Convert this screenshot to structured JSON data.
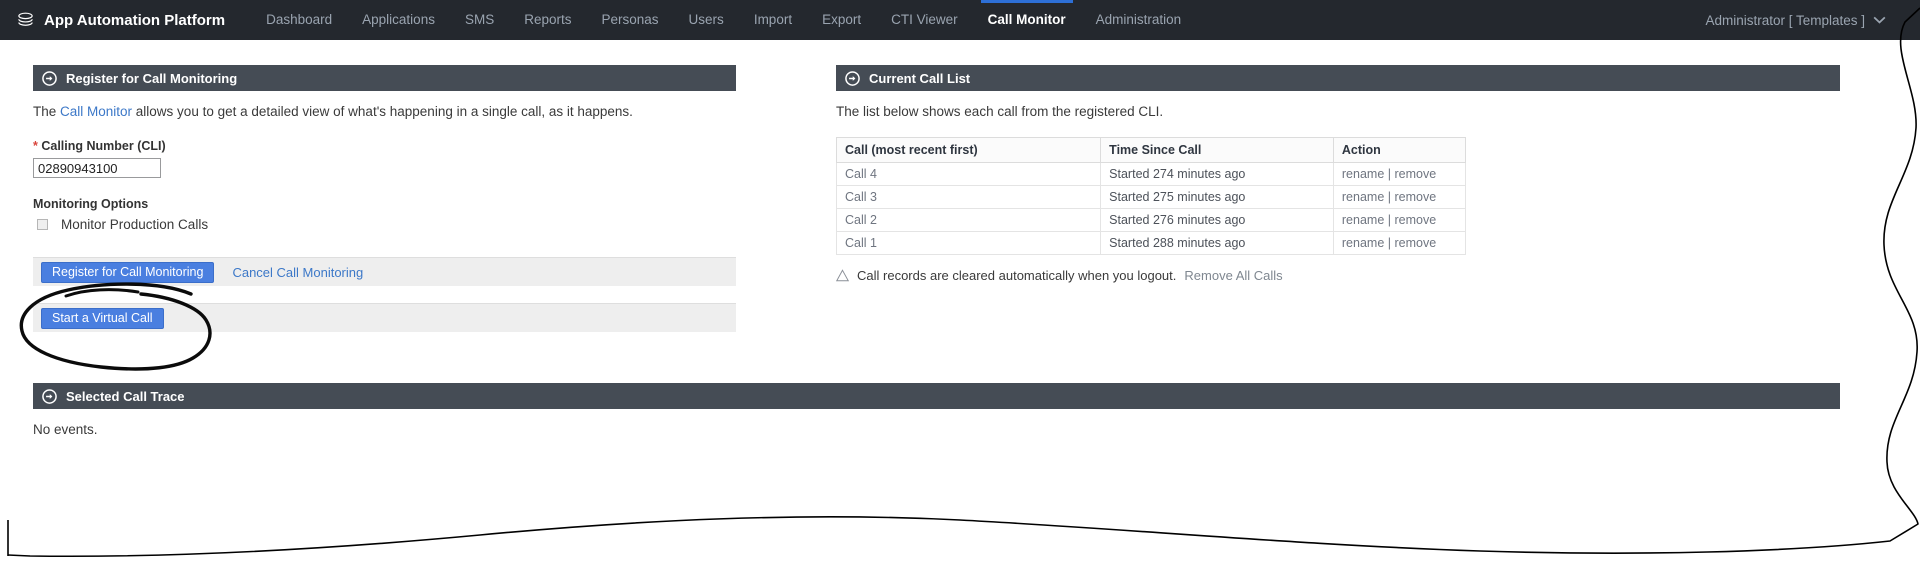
{
  "navbar": {
    "brand": "App Automation Platform",
    "brand_logo_icon": "stacked-discs-logo",
    "items": [
      {
        "label": "Dashboard",
        "active": false
      },
      {
        "label": "Applications",
        "active": false
      },
      {
        "label": "SMS",
        "active": false
      },
      {
        "label": "Reports",
        "active": false
      },
      {
        "label": "Personas",
        "active": false
      },
      {
        "label": "Users",
        "active": false
      },
      {
        "label": "Import",
        "active": false
      },
      {
        "label": "Export",
        "active": false
      },
      {
        "label": "CTI Viewer",
        "active": false
      },
      {
        "label": "Call Monitor",
        "active": true
      },
      {
        "label": "Administration",
        "active": false
      }
    ],
    "user_menu": "Administrator [ Templates ]",
    "user_menu_icon": "chevron-down-icon",
    "active_accent_color": "#2d6fd6",
    "background_color": "#24282e"
  },
  "register_panel": {
    "title": "Register for Call Monitoring",
    "header_icon": "circle-arrow-right-icon",
    "intro_before": "The ",
    "intro_link": "Call Monitor",
    "intro_after": " allows you to get a detailed view of what's happening in a single call, as it happens.",
    "cli_field": {
      "required_marker": "*",
      "label": "Calling Number (CLI)",
      "value": "02890943100",
      "placeholder": ""
    },
    "monitoring_options_title": "Monitoring Options",
    "monitor_production_calls": {
      "label": "Monitor Production Calls",
      "checked": false
    },
    "register_button": "Register for Call Monitoring",
    "cancel_link": "Cancel Call Monitoring",
    "virtual_call_button": "Start a Virtual Call",
    "button_color": "#4a7fe0"
  },
  "call_list_panel": {
    "title": "Current Call List",
    "header_icon": "circle-arrow-right-icon",
    "intro": "The list below shows each call from the registered CLI.",
    "columns": [
      "Call (most recent first)",
      "Time Since Call",
      "Action"
    ],
    "rows": [
      {
        "call": "Call 4",
        "time": "Started 274 minutes ago",
        "action": "rename | remove"
      },
      {
        "call": "Call 3",
        "time": "Started 275 minutes ago",
        "action": "rename | remove"
      },
      {
        "call": "Call 2",
        "time": "Started 276 minutes ago",
        "action": "rename | remove"
      },
      {
        "call": "Call 1",
        "time": "Started 288 minutes ago",
        "action": "rename | remove"
      }
    ],
    "note_icon": "warning-triangle-icon",
    "note_text": "Call records are cleared automatically when you logout.",
    "note_link": "Remove All Calls"
  },
  "call_trace_panel": {
    "title": "Selected Call Trace",
    "header_icon": "circle-arrow-right-icon",
    "empty_text": "No events."
  },
  "annotations": {
    "highlight_ellipse": "hand-drawn-ellipse-around-register-button",
    "crop_edge": "hand-drawn-wavy-crop-boundary"
  }
}
